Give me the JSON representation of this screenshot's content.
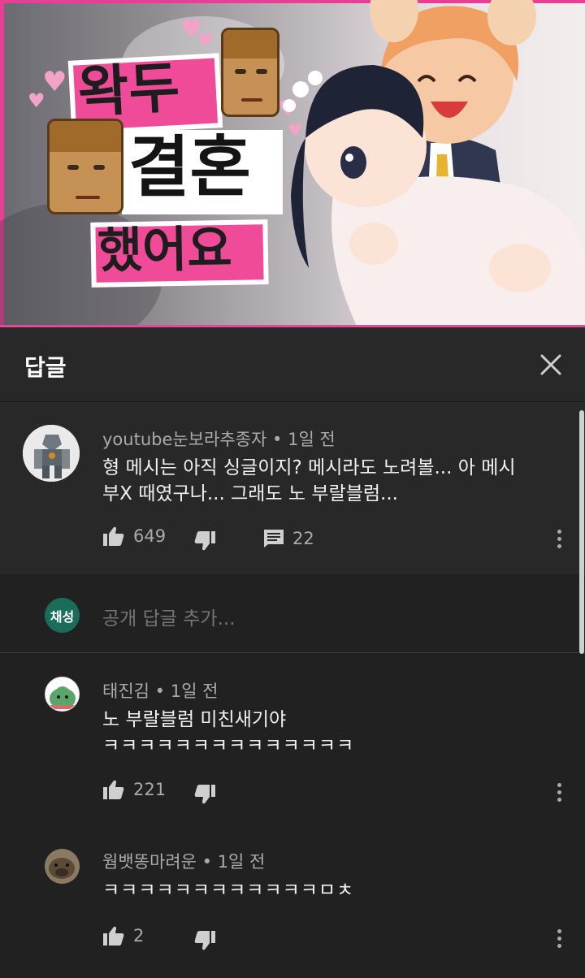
{
  "video": {
    "title_line1": "왁두",
    "title_line2": "결혼",
    "title_line3": "했어요"
  },
  "replies_panel": {
    "title": "답글"
  },
  "parent_comment": {
    "author": "youtube눈보라추종자",
    "time": "1일 전",
    "text_line1": "형 메시는 아직 싱글이지? 메시라도 노려볼... 아 메시",
    "text_line2": "부X 때였구나... 그래도 노 부랄블럼...",
    "likes": "649",
    "reply_count": "22"
  },
  "add_reply": {
    "avatar_text": "채성",
    "placeholder": "공개 답글 추가..."
  },
  "replies": [
    {
      "author": "태진김",
      "time": "1일 전",
      "text_line1": "노 부랄블럼 미친새기야",
      "text_line2": "ㅋㅋㅋㅋㅋㅋㅋㅋㅋㅋㅋㅋㅋㅋ",
      "likes": "221"
    },
    {
      "author": "웜뱃똥마려운",
      "time": "1일 전",
      "text_line1": "ㅋㅋㅋㅋㅋㅋㅋㅋㅋㅋㅋㅋㅁㅊ",
      "likes": "2"
    }
  ],
  "separator": "•",
  "icons": {
    "like": "thumbs-up-icon",
    "dislike": "thumbs-down-icon",
    "reply": "comment-icon",
    "more": "more-vertical-icon",
    "close": "close-icon"
  },
  "colors": {
    "panel_bg": "#282828",
    "page_bg": "#212121",
    "meta_text": "#aaaaaa",
    "thumbnail_pink": "#ef4b99"
  }
}
